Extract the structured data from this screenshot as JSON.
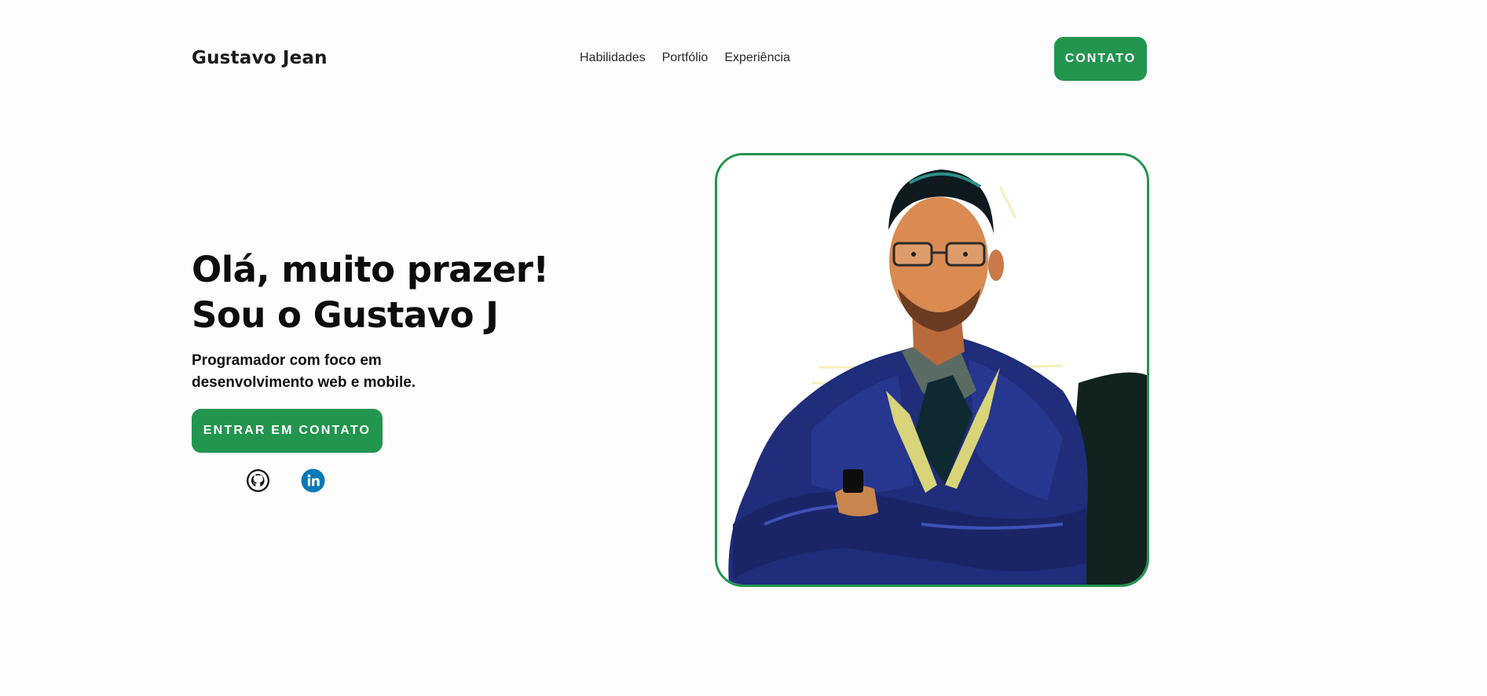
{
  "header": {
    "brand": "Gustavo Jean",
    "nav": [
      "Habilidades",
      "Portfólio",
      "Experiência"
    ],
    "contact_label": "CONTATO"
  },
  "hero": {
    "title_line1": "Olá, muito prazer!",
    "title_line2": "Sou o Gustavo J",
    "subtitle": "Programador com foco em desenvolvimento web e mobile.",
    "cta_label": "ENTRAR EM CONTATO"
  },
  "social": {
    "icons": [
      "github-icon",
      "linkedin-icon"
    ]
  },
  "colors": {
    "accent": "#22954f",
    "background": "#fdfdfd",
    "linkedin": "#0a66c2"
  }
}
